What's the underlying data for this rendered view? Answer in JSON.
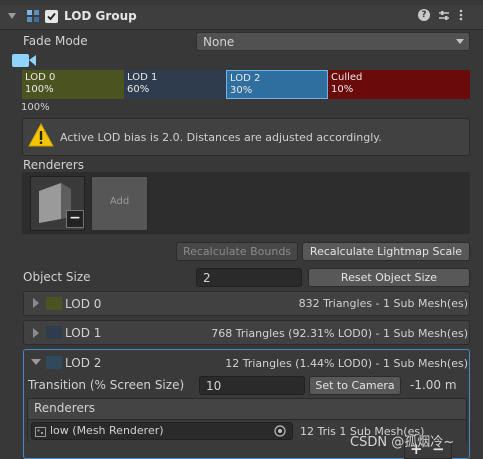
{
  "header": {
    "title": "LOD Group",
    "enabled": true,
    "help_icon": "help-icon",
    "preset_icon": "preset-icon",
    "menu_icon": "kebab-menu-icon"
  },
  "fade_mode": {
    "label": "Fade Mode",
    "value": "None"
  },
  "lod_bar": {
    "top_label": "100%",
    "segments": [
      {
        "name": "LOD 0",
        "percent": "100%",
        "color": "#4b5320"
      },
      {
        "name": "LOD 1",
        "percent": "60%",
        "color": "#2f3c4d"
      },
      {
        "name": "LOD 2",
        "percent": "30%",
        "color": "#2f6fa0"
      },
      {
        "name": "Culled",
        "percent": "10%",
        "color": "#6b0a0a"
      }
    ]
  },
  "warning": {
    "text": "Active LOD bias is 2.0. Distances are adjusted accordingly."
  },
  "renderers": {
    "label": "Renderers",
    "add_label": "Add"
  },
  "buttons": {
    "recalc_bounds": "Recalculate Bounds",
    "recalc_lightmap": "Recalculate Lightmap Scale",
    "reset_size": "Reset Object Size"
  },
  "object_size": {
    "label": "Object Size",
    "value": "2"
  },
  "lods": [
    {
      "label": "LOD 0",
      "info": "832 Triangles  - 1 Sub Mesh(es)",
      "color": "#4b5320"
    },
    {
      "label": "LOD 1",
      "info": "768 Triangles (92.31% LOD0) - 1 Sub Mesh(es)",
      "color": "#2f3c4d"
    },
    {
      "label": "LOD 2",
      "info": "12 Triangles (1.44% LOD0) - 1 Sub Mesh(es)",
      "color": "#2f4a5c"
    }
  ],
  "lod2_detail": {
    "transition_label": "Transition (% Screen Size)",
    "transition_value": "10",
    "set_camera": "Set to Camera",
    "distance": "-1.00 m",
    "renderers_label": "Renderers",
    "renderer_name": "low (Mesh Renderer)",
    "renderer_info": "12 Tris 1 Sub Mesh(es)"
  },
  "watermark": "CSDN @孤烟冷~"
}
